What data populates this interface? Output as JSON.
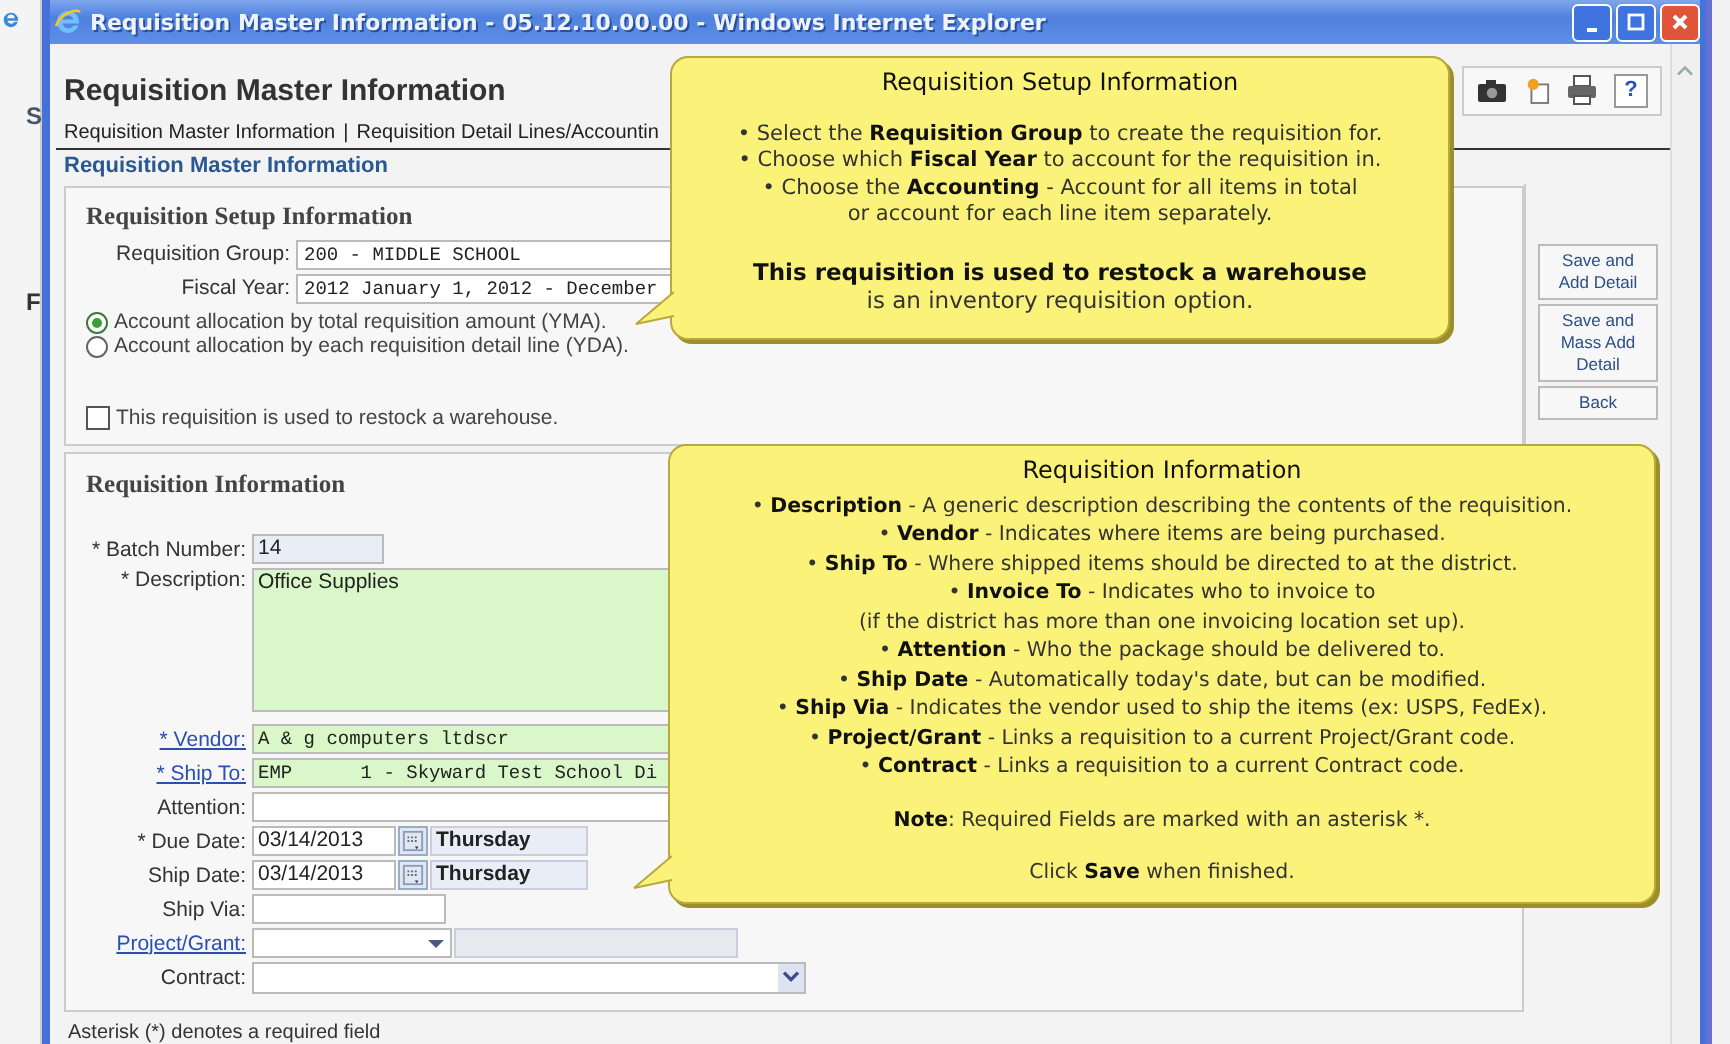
{
  "background_window": {
    "letters": [
      "S",
      "F"
    ]
  },
  "window": {
    "title": "Requisition Master Information - 05.12.10.00.00 - Windows Internet Explorer"
  },
  "page": {
    "title": "Requisition Master Information",
    "toolbar": [
      {
        "kind": "camera"
      },
      {
        "kind": "note"
      },
      {
        "kind": "print"
      },
      {
        "kind": "help",
        "label": "?"
      }
    ],
    "nav": {
      "items": [
        "Requisition Master Information",
        "Requisition Detail Lines/Accountin"
      ],
      "separator": "|"
    },
    "section_heading": "Requisition Master Information"
  },
  "setup": {
    "title": "Requisition Setup Information",
    "fields": [
      {
        "label": "Requisition Group:",
        "value": "200 - MIDDLE SCHOOL"
      },
      {
        "label": "Fiscal Year:",
        "value": "2012 January 1, 2012 - December"
      }
    ],
    "allocation": [
      {
        "label": "Account allocation by total requisition amount (YMA).",
        "selected": true
      },
      {
        "label": "Account allocation by each requisition detail line (YDA).",
        "selected": false
      }
    ],
    "restock": {
      "label": "This requisition is used to restock a warehouse.",
      "checked": false
    }
  },
  "actions": [
    "Save and\nAdd Detail",
    "Save and\nMass Add\nDetail",
    "Back"
  ],
  "info": {
    "title": "Requisition Information",
    "fields": [
      {
        "kind": "number",
        "label": "* Batch Number:",
        "link": false,
        "value": "14",
        "readonly": true,
        "highlighted": false
      },
      {
        "kind": "memo",
        "label": "* Description:",
        "link": false,
        "value": "Office Supplies",
        "readonly": false,
        "highlighted": true
      },
      {
        "kind": "wide",
        "label": "* Vendor:",
        "link": true,
        "value": "A & g computers ltdscr",
        "readonly": false,
        "highlighted": true
      },
      {
        "kind": "wide",
        "label": "* Ship To:",
        "link": true,
        "value": "EMP      1 - Skyward Test School Di",
        "readonly": false,
        "highlighted": true
      },
      {
        "kind": "wide",
        "label": "Attention:",
        "link": false,
        "readonly": false,
        "highlighted": false
      },
      {
        "kind": "date",
        "label": "* Due Date:",
        "link": false,
        "value": "03/14/2013",
        "day": "Thursday",
        "readonly": false,
        "highlighted": false
      },
      {
        "kind": "date",
        "label": "Ship Date:",
        "link": false,
        "value": "03/14/2013",
        "day": "Thursday",
        "readonly": false,
        "highlighted": false
      },
      {
        "kind": "short",
        "label": "Ship Via:",
        "link": false,
        "readonly": false,
        "highlighted": false
      },
      {
        "kind": "lookup",
        "label": "Project/Grant:",
        "link": true,
        "readonly": false,
        "highlighted": false
      },
      {
        "kind": "select",
        "label": "Contract:",
        "link": false,
        "readonly": false,
        "highlighted": false
      }
    ]
  },
  "footer": "Asterisk (*) denotes a required field",
  "callouts": [
    {
      "title": "Requisition Setup Information",
      "paragraphs": [
        "• Select the **Requisition Group** to create the requisition for.\n• Choose which **Fiscal Year** to account for the requisition in.\n• Choose the **Accounting** - Account for all items in total\nor account for each line item separately.",
        "**This requisition is used to restock a warehouse**\nis an inventory requisition option."
      ]
    },
    {
      "title": "Requisition Information",
      "paragraphs": [
        "• **Description** - A generic description describing the contents of the requisition.\n• **Vendor** - Indicates where items are being purchased.\n• **Ship To** - Where shipped items should be directed to at the district.\n• **Invoice To** - Indicates who to invoice to\n(if the district has more than one invoicing location set up).\n• **Attention** - Who the package should be delivered to.\n• **Ship Date** - Automatically today's date, but can be modified.\n• **Ship Via** - Indicates the vendor used to ship the items (ex: USPS, FedEx).\n• **Project/Grant** - Links a requisition to a current Project/Grant code.\n• **Contract** - Links a requisition to a current Contract code.",
        "**Note**: Required Fields are marked with an asterisk *.",
        "Click **Save** when finished."
      ]
    }
  ]
}
